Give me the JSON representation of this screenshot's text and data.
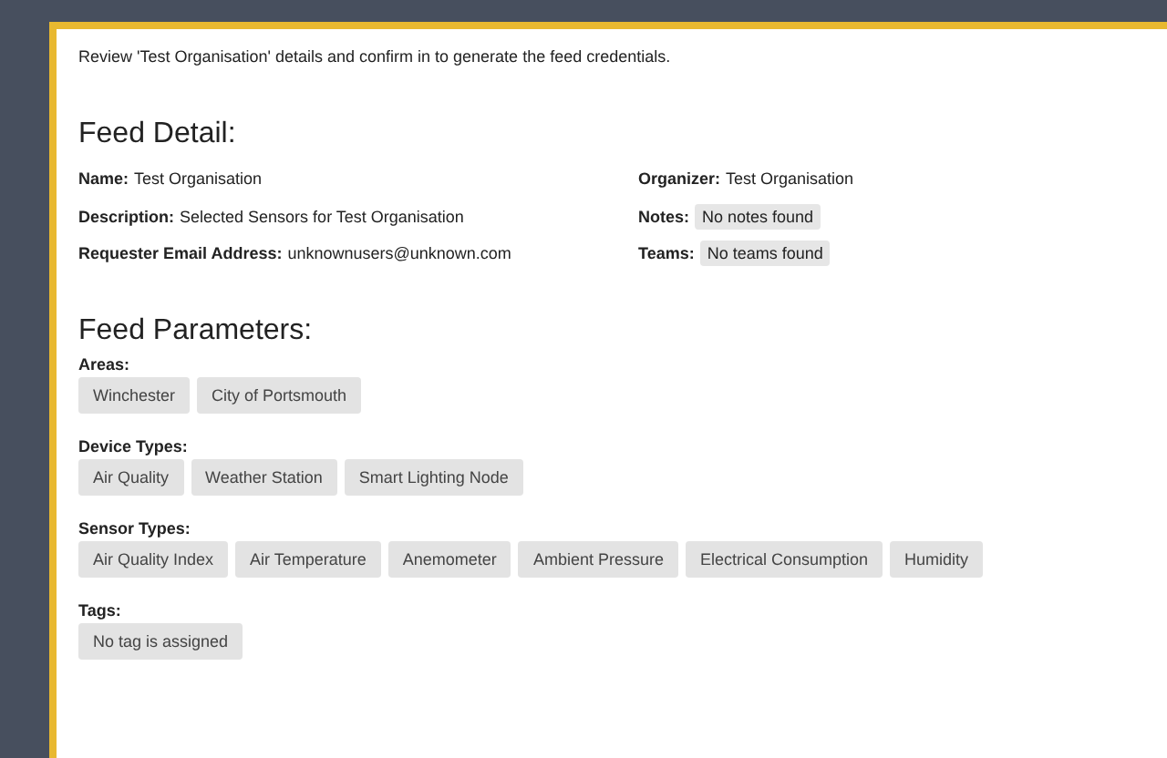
{
  "intro": "Review 'Test Organisation' details and confirm in to generate the feed credentials.",
  "feed_detail": {
    "title": "Feed Detail:",
    "left": [
      {
        "label": "Name:",
        "value": "Test Organisation",
        "kind": "text"
      },
      {
        "label": "Description:",
        "value": "Selected Sensors for Test Organisation",
        "kind": "text"
      },
      {
        "label": "Requester Email Address:",
        "value": "unknownusers@unknown.com",
        "kind": "text"
      }
    ],
    "right": [
      {
        "label": "Organizer:",
        "value": "Test Organisation",
        "kind": "text"
      },
      {
        "label": "Notes:",
        "value": "No notes found",
        "kind": "chip"
      },
      {
        "label": "Teams:",
        "value": "No teams found",
        "kind": "chip"
      }
    ]
  },
  "feed_parameters": {
    "title": "Feed Parameters:",
    "groups": [
      {
        "label": "Areas:",
        "chips": [
          "Winchester",
          "City of Portsmouth"
        ]
      },
      {
        "label": "Device Types:",
        "chips": [
          "Air Quality",
          "Weather Station",
          "Smart Lighting Node"
        ]
      },
      {
        "label": "Sensor Types:",
        "chips": [
          "Air Quality Index",
          "Air Temperature",
          "Anemometer",
          "Ambient Pressure",
          "Electrical Consumption",
          "Humidity"
        ]
      },
      {
        "label": "Tags:",
        "chips": [
          "No tag is assigned"
        ]
      }
    ]
  }
}
